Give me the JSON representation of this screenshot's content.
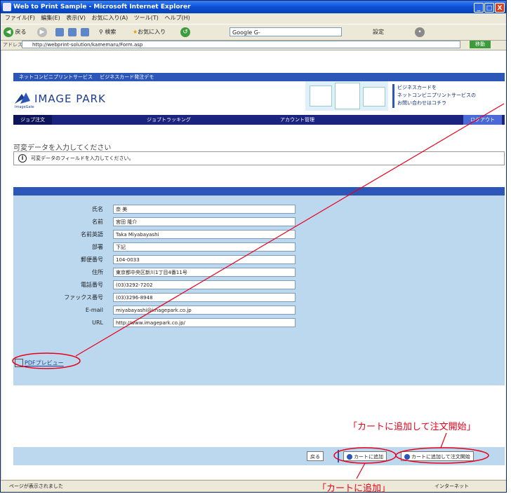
{
  "window": {
    "title": "Web to Print Sample - Microsoft Internet Explorer",
    "controls": [
      "_",
      "□",
      "X"
    ]
  },
  "menu": [
    "ファイル(F)",
    "編集(E)",
    "表示(V)",
    "お気に入り(A)",
    "ツール(T)",
    "ヘルプ(H)"
  ],
  "toolbar": {
    "back": "戻る",
    "search": "検索",
    "favorites": "お気に入り",
    "google_label": "Google",
    "google_value": "G-",
    "settings": "設定"
  },
  "address": {
    "label": "アドレス(D)",
    "url": "http://webprint-solution/kamemaru/Form.asp",
    "go": "移動"
  },
  "site": {
    "top_links": [
      "ネットコンビニプリントサービス",
      "ビジネスカード発注デモ"
    ],
    "logo_text": "IMAGE PARK",
    "logo_sub": "ImageGate",
    "banner_lines": [
      "ビジネスカードを",
      "ネットコンビニプリントサービスの",
      "お問い合わせはコチラ"
    ],
    "nav": [
      "ジョブ注文",
      "ジョブトラッキング",
      "アカウント管理",
      "ログアウト"
    ],
    "heading": "可変データを入力してください",
    "info": "可変データのフィールドを入力してください。"
  },
  "form": {
    "fields": [
      {
        "label": "氏名",
        "value": "奈 美"
      },
      {
        "label": "名前",
        "value": "宮田 隆介"
      },
      {
        "label": "名前英語",
        "value": "Taka Miyabayashi"
      },
      {
        "label": "部署",
        "value": "下記"
      },
      {
        "label": "郵便番号",
        "value": "104-0033"
      },
      {
        "label": "住所",
        "value": "東京都中央区新川1丁目4番11号"
      },
      {
        "label": "電話番号",
        "value": "(03)3292-7202"
      },
      {
        "label": "ファックス番号",
        "value": "(03)3296-8948"
      },
      {
        "label": "E-mail",
        "value": "miyabayashi@imagepark.co.jp"
      },
      {
        "label": "URL",
        "value": "http://www.imagepark.co.jp/"
      }
    ],
    "preview_link": "PDFプレビュー"
  },
  "buttons": {
    "back": "戻る",
    "add_to_cart": "カートに追加",
    "add_and_order": "カートに追加して注文開始"
  },
  "status": {
    "left": "ページが表示されました",
    "right": "インターネット"
  },
  "annotations": {
    "add_and_order": "「カートに追加して注文開始」",
    "add_to_cart": "「カートに追加」"
  },
  "colors": {
    "accent": "#2c57b8",
    "annotation": "#e8001a",
    "panel": "#bcd8ee"
  }
}
